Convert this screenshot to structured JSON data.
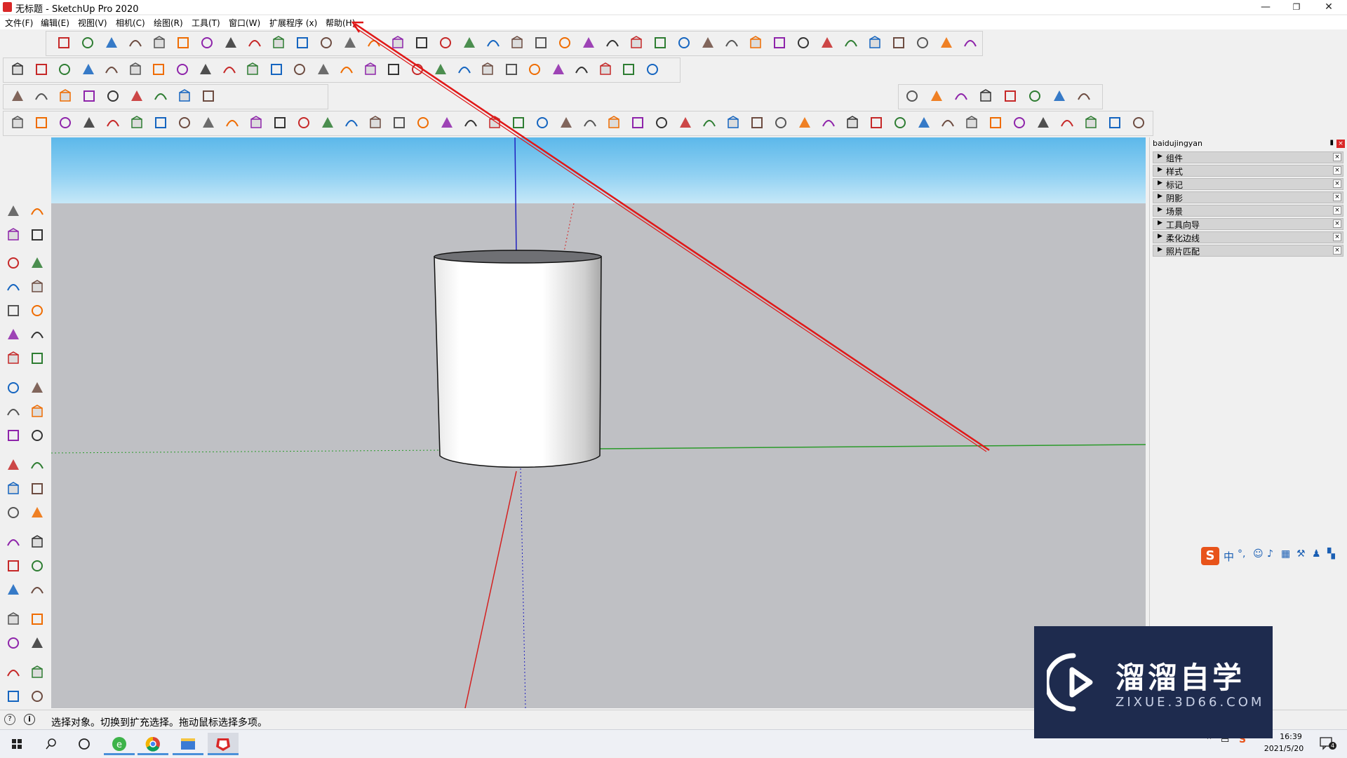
{
  "window": {
    "title": "无标题 - SketchUp Pro 2020",
    "minimize": "—",
    "restore": "❐",
    "close": "✕"
  },
  "menu": {
    "items": [
      "文件(F)",
      "编辑(E)",
      "视图(V)",
      "相机(C)",
      "绘图(R)",
      "工具(T)",
      "窗口(W)",
      "扩展程序 (x)",
      "帮助(H)"
    ]
  },
  "tray": {
    "header": "baidujingyan",
    "panels": [
      "组件",
      "样式",
      "标记",
      "阴影",
      "场景",
      "工具向导",
      "柔化边线",
      "照片匹配"
    ],
    "close": "×"
  },
  "status": {
    "text": "选择对象。切换到扩充选择。拖动鼠标选择多项。"
  },
  "taskbar": {
    "time": "16:39",
    "date": "2021/5/20",
    "notifications": "4"
  },
  "watermark": {
    "main": "溜溜自学",
    "sub": "ZIXUE.3D66.COM"
  },
  "ime": {
    "label": "中"
  },
  "colors": {
    "sky_top": "#5cb8ea",
    "ground": "#bfc0c4",
    "axis_red": "#d42020",
    "axis_green": "#2a9a2a",
    "axis_blue": "#2020c0",
    "annotation_arrow": "#e01818"
  }
}
